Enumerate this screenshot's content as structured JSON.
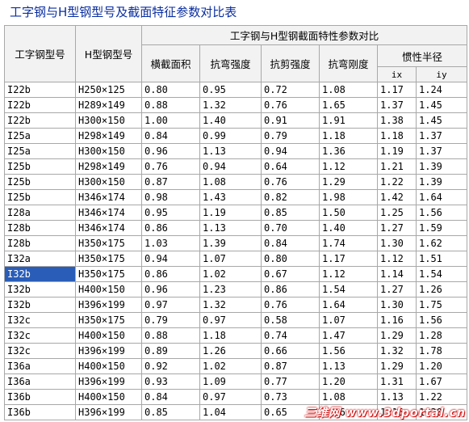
{
  "title": "工字钢与H型钢型号及截面特征参数对比表",
  "headers": {
    "col_i_model": "工字钢型号",
    "col_h_model": "H型钢型号",
    "group_title": "工字钢与H型钢截面特性参数对比",
    "area": "横截面积",
    "bending_strength": "抗弯强度",
    "shear_strength": "抗剪强度",
    "bending_stiffness": "抗弯刚度",
    "radius_group": "惯性半径",
    "ix": "ix",
    "iy": "iy"
  },
  "rows": [
    [
      "I22b",
      "H250×125",
      "0.80",
      "0.95",
      "0.72",
      "1.08",
      "1.17",
      "1.24"
    ],
    [
      "I22b",
      "H289×149",
      "0.88",
      "1.32",
      "0.76",
      "1.65",
      "1.37",
      "1.45"
    ],
    [
      "I22b",
      "H300×150",
      "1.00",
      "1.40",
      "0.91",
      "1.91",
      "1.38",
      "1.45"
    ],
    [
      "I25a",
      "H298×149",
      "0.84",
      "0.99",
      "0.79",
      "1.18",
      "1.18",
      "1.37"
    ],
    [
      "I25a",
      "H300×150",
      "0.96",
      "1.13",
      "0.94",
      "1.36",
      "1.19",
      "1.37"
    ],
    [
      "I25b",
      "H298×149",
      "0.76",
      "0.94",
      "0.64",
      "1.12",
      "1.21",
      "1.39"
    ],
    [
      "I25b",
      "H300×150",
      "0.87",
      "1.08",
      "0.76",
      "1.29",
      "1.22",
      "1.39"
    ],
    [
      "I25b",
      "H346×174",
      "0.98",
      "1.43",
      "0.82",
      "1.98",
      "1.42",
      "1.64"
    ],
    [
      "I28a",
      "H346×174",
      "0.95",
      "1.19",
      "0.85",
      "1.50",
      "1.25",
      "1.56"
    ],
    [
      "I28b",
      "H346×174",
      "0.86",
      "1.13",
      "0.70",
      "1.40",
      "1.27",
      "1.59"
    ],
    [
      "I28b",
      "H350×175",
      "1.03",
      "1.39",
      "0.84",
      "1.74",
      "1.30",
      "1.62"
    ],
    [
      "I32a",
      "H350×175",
      "0.94",
      "1.07",
      "0.80",
      "1.17",
      "1.12",
      "1.51"
    ],
    [
      "I32b",
      "H350×175",
      "0.86",
      "1.02",
      "0.67",
      "1.12",
      "1.14",
      "1.54"
    ],
    [
      "I32b",
      "H400×150",
      "0.96",
      "1.23",
      "0.86",
      "1.54",
      "1.27",
      "1.26"
    ],
    [
      "I32b",
      "H396×199",
      "0.97",
      "1.32",
      "0.76",
      "1.64",
      "1.30",
      "1.75"
    ],
    [
      "I32c",
      "H350×175",
      "0.79",
      "0.97",
      "0.58",
      "1.07",
      "1.16",
      "1.56"
    ],
    [
      "I32c",
      "H400×150",
      "0.88",
      "1.18",
      "0.74",
      "1.47",
      "1.29",
      "1.28"
    ],
    [
      "I32c",
      "H396×199",
      "0.89",
      "1.26",
      "0.66",
      "1.56",
      "1.32",
      "1.78"
    ],
    [
      "I36a",
      "H400×150",
      "0.92",
      "1.02",
      "0.87",
      "1.13",
      "1.29",
      "1.20"
    ],
    [
      "I36a",
      "H396×199",
      "0.93",
      "1.09",
      "0.77",
      "1.20",
      "1.31",
      "1.67"
    ],
    [
      "I36b",
      "H400×150",
      "0.84",
      "0.97",
      "0.73",
      "1.08",
      "1.13",
      "1.22"
    ],
    [
      "I36b",
      "H396×199",
      "0.85",
      "1.04",
      "0.65",
      "1.16",
      "1.16",
      "1.20"
    ]
  ],
  "selected_row_index": 12,
  "watermark": "三维网 www.3dportal.cn",
  "colors": {
    "title": "#0a2ea0",
    "selected": "#2a5db7",
    "header_bg": "#f2f2f2",
    "grid": "#a8a8a8"
  }
}
